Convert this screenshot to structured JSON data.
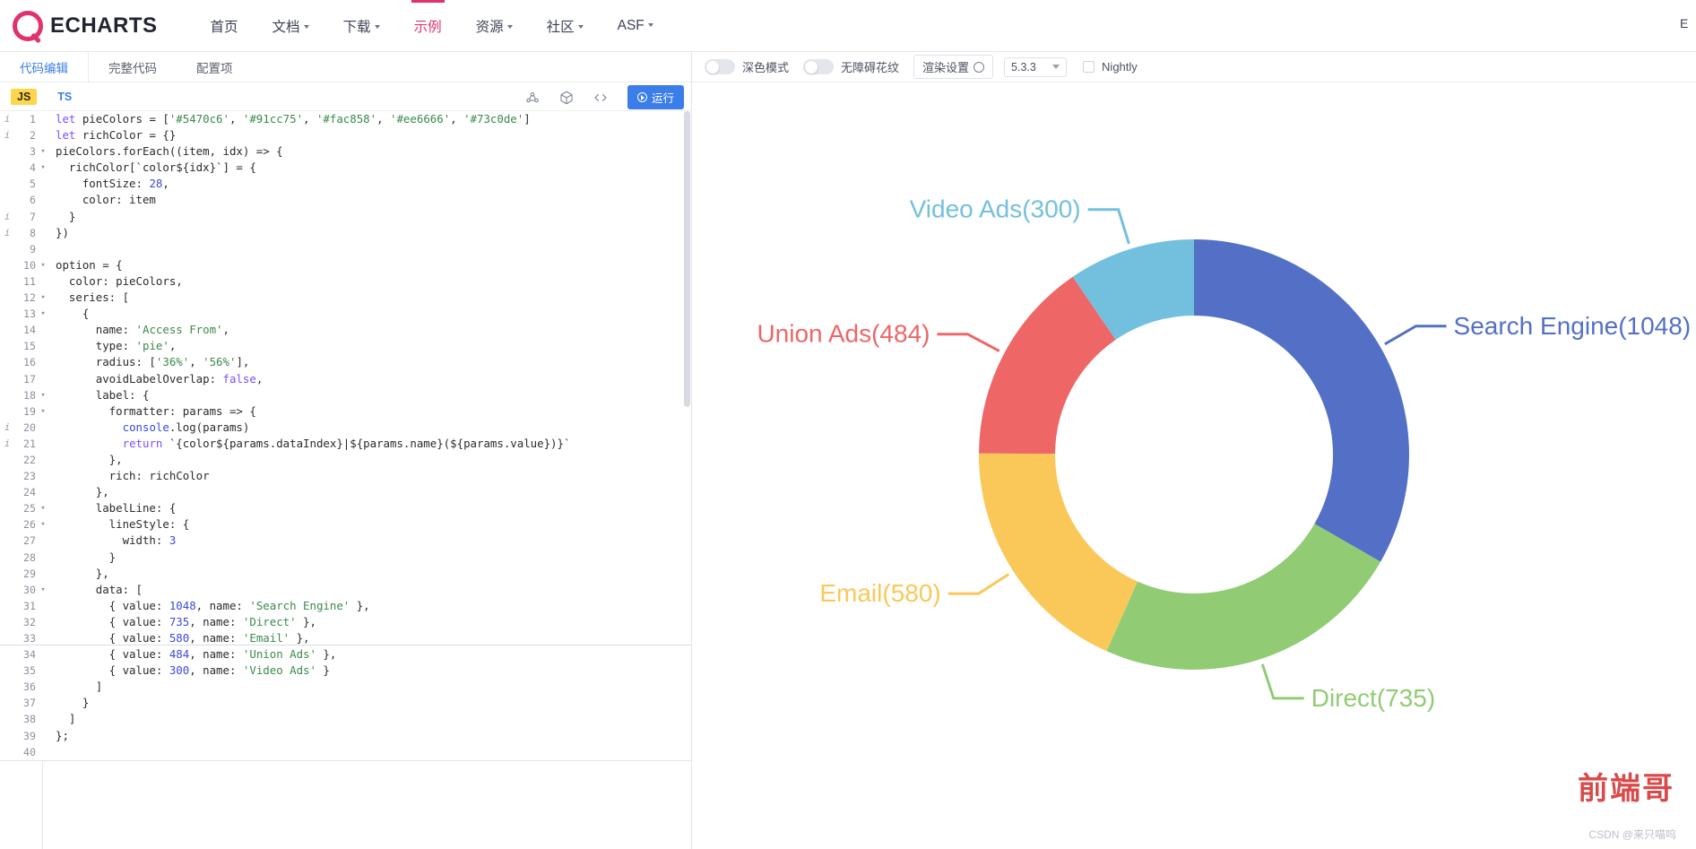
{
  "navbar": {
    "brand": "ECHARTS",
    "items": [
      {
        "label": "首页",
        "has_caret": false,
        "active": false
      },
      {
        "label": "文档",
        "has_caret": true,
        "active": false
      },
      {
        "label": "下载",
        "has_caret": true,
        "active": false
      },
      {
        "label": "示例",
        "has_caret": false,
        "active": true
      },
      {
        "label": "资源",
        "has_caret": true,
        "active": false
      },
      {
        "label": "社区",
        "has_caret": true,
        "active": false
      },
      {
        "label": "ASF",
        "has_caret": true,
        "active": false
      }
    ],
    "right_clipped": "E"
  },
  "editor": {
    "tabs": [
      {
        "label": "代码编辑",
        "active": true
      },
      {
        "label": "完整代码",
        "active": false
      },
      {
        "label": "配置项",
        "active": false
      }
    ],
    "lang_js": "JS",
    "lang_ts": "TS",
    "run_label": "运行",
    "icons": {
      "share": "share-nodes-icon",
      "cube": "cube-icon",
      "code": "code-brackets-icon"
    },
    "code_lines": [
      {
        "n": "1",
        "info": true,
        "fold": "",
        "html": "<span class=\"kw\">let</span> pieColors = [<span class=\"str\">'#5470c6'</span>, <span class=\"str\">'#91cc75'</span>, <span class=\"str\">'#fac858'</span>, <span class=\"str\">'#ee6666'</span>, <span class=\"str\">'#73c0de'</span>]"
      },
      {
        "n": "2",
        "info": true,
        "fold": "",
        "html": "<span class=\"kw\">let</span> richColor = {}"
      },
      {
        "n": "3",
        "info": false,
        "fold": "▾",
        "html": "pieColors.forEach((item, idx) =&gt; {"
      },
      {
        "n": "4",
        "info": false,
        "fold": "▾",
        "html": "  richColor[`color${idx}`] = {"
      },
      {
        "n": "5",
        "info": false,
        "fold": "",
        "html": "    fontSize: <span class=\"num\">28</span>,"
      },
      {
        "n": "6",
        "info": false,
        "fold": "",
        "html": "    color: item"
      },
      {
        "n": "7",
        "info": true,
        "fold": "",
        "html": "  }"
      },
      {
        "n": "8",
        "info": true,
        "fold": "",
        "html": "})"
      },
      {
        "n": "9",
        "info": false,
        "fold": "",
        "html": ""
      },
      {
        "n": "10",
        "info": false,
        "fold": "▾",
        "html": "option = {"
      },
      {
        "n": "11",
        "info": false,
        "fold": "",
        "html": "  color: pieColors,"
      },
      {
        "n": "12",
        "info": false,
        "fold": "▾",
        "html": "  series: ["
      },
      {
        "n": "13",
        "info": false,
        "fold": "▾",
        "html": "    {"
      },
      {
        "n": "14",
        "info": false,
        "fold": "",
        "html": "      name: <span class=\"str\">'Access From'</span>,"
      },
      {
        "n": "15",
        "info": false,
        "fold": "",
        "html": "      type: <span class=\"str\">'pie'</span>,"
      },
      {
        "n": "16",
        "info": false,
        "fold": "",
        "html": "      radius: [<span class=\"str\">'36%'</span>, <span class=\"str\">'56%'</span>],"
      },
      {
        "n": "17",
        "info": false,
        "fold": "",
        "html": "      avoidLabelOverlap: <span class=\"bool\">false</span>,"
      },
      {
        "n": "18",
        "info": false,
        "fold": "▾",
        "html": "      label: {"
      },
      {
        "n": "19",
        "info": false,
        "fold": "▾",
        "html": "        formatter: params =&gt; {"
      },
      {
        "n": "20",
        "info": true,
        "fold": "",
        "html": "          <span class=\"fn\">console</span>.log(params)"
      },
      {
        "n": "21",
        "info": true,
        "fold": "",
        "html": "          <span class=\"kw\">return</span> `{color${params.dataIndex}|${params.name}(${params.value})}`"
      },
      {
        "n": "22",
        "info": false,
        "fold": "",
        "html": "        },"
      },
      {
        "n": "23",
        "info": false,
        "fold": "",
        "html": "        rich: richColor"
      },
      {
        "n": "24",
        "info": false,
        "fold": "",
        "html": "      },"
      },
      {
        "n": "25",
        "info": false,
        "fold": "▾",
        "html": "      labelLine: {"
      },
      {
        "n": "26",
        "info": false,
        "fold": "▾",
        "html": "        lineStyle: {"
      },
      {
        "n": "27",
        "info": false,
        "fold": "",
        "html": "          width: <span class=\"num\">3</span>"
      },
      {
        "n": "28",
        "info": false,
        "fold": "",
        "html": "        }"
      },
      {
        "n": "29",
        "info": false,
        "fold": "",
        "html": "      },"
      },
      {
        "n": "30",
        "info": false,
        "fold": "▾",
        "html": "      data: ["
      },
      {
        "n": "31",
        "info": false,
        "fold": "",
        "html": "        { value: <span class=\"num\">1048</span>, name: <span class=\"str\">'Search Engine'</span> },"
      },
      {
        "n": "32",
        "info": false,
        "fold": "",
        "html": "        { value: <span class=\"num\">735</span>, name: <span class=\"str\">'Direct'</span> },"
      },
      {
        "n": "33",
        "info": false,
        "fold": "",
        "html": "        { value: <span class=\"num\">580</span>, name: <span class=\"str\">'Email'</span> },"
      },
      {
        "n": "34",
        "info": false,
        "fold": "",
        "html": "        { value: <span class=\"num\">484</span>, name: <span class=\"str\">'Union Ads'</span> },"
      },
      {
        "n": "35",
        "info": false,
        "fold": "",
        "html": "        { value: <span class=\"num\">300</span>, name: <span class=\"str\">'Video Ads'</span> }"
      },
      {
        "n": "36",
        "info": false,
        "fold": "",
        "html": "      ]"
      },
      {
        "n": "37",
        "info": false,
        "fold": "",
        "html": "    }"
      },
      {
        "n": "38",
        "info": false,
        "fold": "",
        "html": "  ]"
      },
      {
        "n": "39",
        "info": false,
        "fold": "",
        "html": "};"
      },
      {
        "n": "40",
        "info": false,
        "fold": "",
        "html": ""
      }
    ]
  },
  "preview_toolbar": {
    "dark_mode_label": "深色模式",
    "dark_mode_on": false,
    "accessible_label": "无障碍花纹",
    "accessible_on": false,
    "render_settings_label": "渲染设置",
    "version": "5.3.3",
    "nightly_label": "Nightly",
    "nightly_checked": false
  },
  "watermark": {
    "text": "前端哥",
    "credit": "CSDN @来只喵呜"
  },
  "chart_data": {
    "type": "pie",
    "title": "",
    "name": "Access From",
    "donut": true,
    "inner_radius_pct": 36,
    "outer_radius_pct": 56,
    "categories": [
      "Search Engine",
      "Direct",
      "Email",
      "Union Ads",
      "Video Ads"
    ],
    "values": [
      1048,
      735,
      580,
      484,
      300
    ],
    "colors": [
      "#5470c6",
      "#91cc75",
      "#fac858",
      "#ee6666",
      "#73c0de"
    ],
    "labels": [
      {
        "name": "Search Engine",
        "value": 1048,
        "text": "Search Engine(1048)",
        "color": "#5470c6"
      },
      {
        "name": "Direct",
        "value": 735,
        "text": "Direct(735)",
        "color": "#91cc75"
      },
      {
        "name": "Email",
        "value": 580,
        "text": "Email(580)",
        "color": "#fac858"
      },
      {
        "name": "Union Ads",
        "value": 484,
        "text": "Union Ads(484)",
        "color": "#ee6666"
      },
      {
        "name": "Video Ads",
        "value": 300,
        "text": "Video Ads(300)",
        "color": "#73c0de"
      }
    ],
    "label_font_size": 28,
    "label_line_width": 3,
    "legend_position": "none",
    "grid": false
  }
}
